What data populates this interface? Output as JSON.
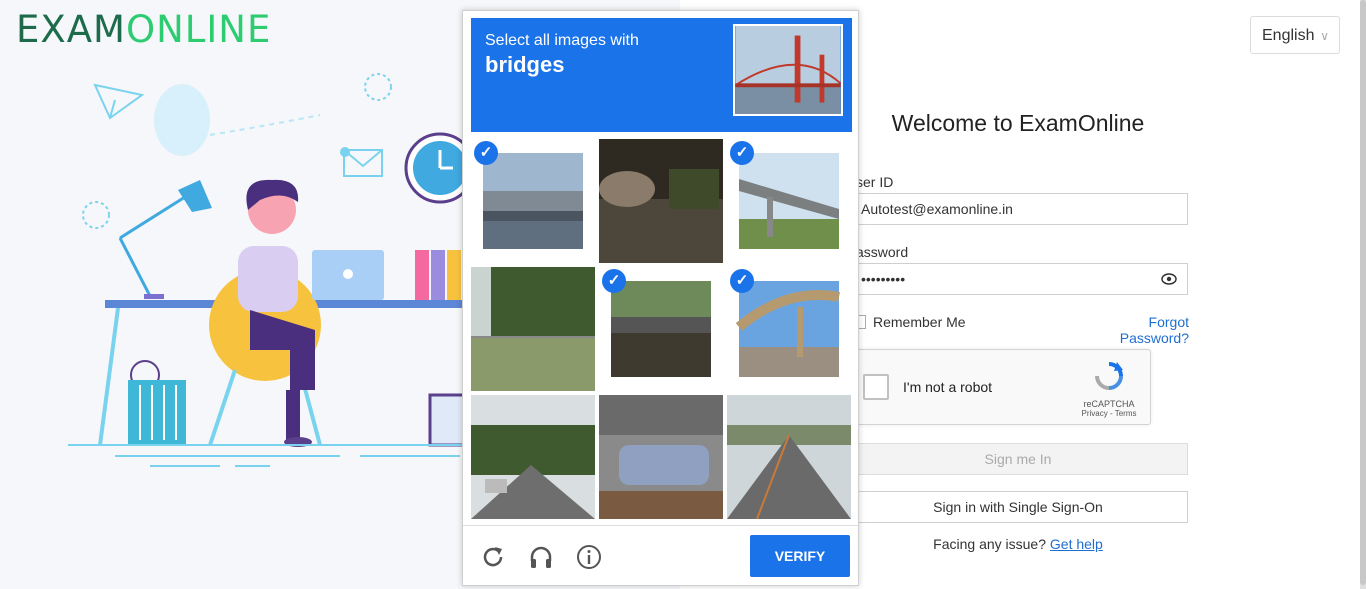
{
  "brand": {
    "logo_part1": "EXAM",
    "logo_part2": "ONLINE"
  },
  "header": {
    "language": "English"
  },
  "login": {
    "title": "Welcome to ExamOnline",
    "user_id_label": "ser ID",
    "user_id_value": "Autotest@examonline.in",
    "password_label": "assword",
    "password_value": "•••••••••",
    "remember_label": "Remember Me",
    "forgot_label": "Forgot Password?",
    "signin_label": "Sign me In",
    "sso_label": "Sign in with Single Sign-On",
    "help_text": "Facing any issue?",
    "help_link": "Get help"
  },
  "recaptcha": {
    "checkbox_label": "I'm not a robot",
    "brand": "reCAPTCHA",
    "terms": "Privacy - Terms"
  },
  "captcha_challenge": {
    "instruction": "Select all images with",
    "target": "bridges",
    "verify_label": "VERIFY",
    "tiles": [
      {
        "index": 1,
        "selected": true
      },
      {
        "index": 2,
        "selected": false
      },
      {
        "index": 3,
        "selected": true
      },
      {
        "index": 4,
        "selected": false
      },
      {
        "index": 5,
        "selected": true
      },
      {
        "index": 6,
        "selected": true
      },
      {
        "index": 7,
        "selected": false
      },
      {
        "index": 8,
        "selected": false
      },
      {
        "index": 9,
        "selected": false
      }
    ],
    "icons": [
      "reload-icon",
      "audio-icon",
      "info-icon"
    ]
  },
  "colors": {
    "accent": "#1a73e8",
    "logo_dark": "#1e6b4c",
    "logo_light": "#2ecc71",
    "link": "#1f6fd1"
  }
}
